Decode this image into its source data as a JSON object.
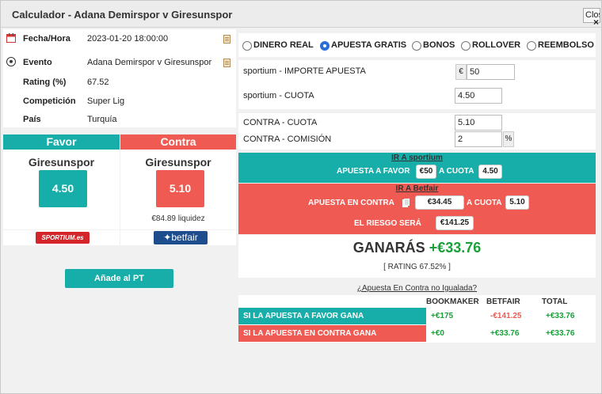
{
  "window": {
    "title": "Calculador - Adana Demirspor v Giresunspor",
    "close_label": "Close",
    "close_x": "×"
  },
  "info": [
    {
      "label": "Fecha/Hora",
      "value": "2023-01-20 18:00:00"
    },
    {
      "label": "Evento",
      "value": "Adana Demirspor v Giresunspor"
    },
    {
      "label": "Rating (%)",
      "value": "67.52"
    },
    {
      "label": "Competición",
      "value": "Super Lig"
    },
    {
      "label": "País",
      "value": "Turquía"
    }
  ],
  "favor": {
    "header": "Favor",
    "team": "Giresunspor",
    "odds": "4.50",
    "bookmaker_logo": "SPORTIUM.es"
  },
  "contra": {
    "header": "Contra",
    "team": "Giresunspor",
    "odds": "5.10",
    "liquidez": "€84.89 liquidez",
    "exchange_logo": "betfair"
  },
  "add_button": "Añade al PT",
  "bet_types": [
    {
      "label": "DINERO REAL",
      "checked": false
    },
    {
      "label": "APUESTA GRATIS",
      "checked": true
    },
    {
      "label": "BONOS",
      "checked": false
    },
    {
      "label": "ROLLOVER",
      "checked": false
    },
    {
      "label": "REEMBOLSO",
      "checked": false
    }
  ],
  "inputs": {
    "stake_label": "sportium - IMPORTE APUESTA",
    "stake_prefix": "€",
    "stake_value": "50",
    "odds_label": "sportium - CUOTA",
    "odds_value": "4.50",
    "lay_odds_label": "CONTRA - CUOTA",
    "lay_odds_value": "5.10",
    "commission_label": "CONTRA - COMISIÓN",
    "commission_value": "2",
    "commission_suffix": "%"
  },
  "ir_sportium": {
    "title": "IR A sportium",
    "text1": "APUESTA A FAVOR",
    "amount": "€50",
    "text2": "A CUOTA",
    "odds": "4.50"
  },
  "ir_betfair": {
    "title": "IR A Betfair",
    "text1": "APUESTA EN CONTRA",
    "amount": "€34.45",
    "text2": "A CUOTA",
    "odds": "5.10",
    "risk_label": "EL RIESGO SERÁ",
    "risk": "€141.25"
  },
  "result": {
    "label": "GANARÁS",
    "amount": "+€33.76",
    "rating": "[ RATING 67.52% ]"
  },
  "unmatched_link": "¿Apuesta En Contra no Igualada?",
  "table": {
    "headers": [
      "BOOKMAKER",
      "BETFAIR",
      "TOTAL"
    ],
    "rows": [
      {
        "label": "SI LA APUESTA A FAVOR GANA",
        "bookmaker": "+€175",
        "betfair": "-€141.25",
        "total": "+€33.76"
      },
      {
        "label": "SI LA APUESTA EN CONTRA GANA",
        "bookmaker": "+€0",
        "betfair": "+€33.76",
        "total": "+€33.76"
      }
    ]
  },
  "colors": {
    "teal": "#17aeaa",
    "red": "#ef5b52",
    "green": "#19a03a",
    "radio_blue": "#2b6fd6"
  }
}
